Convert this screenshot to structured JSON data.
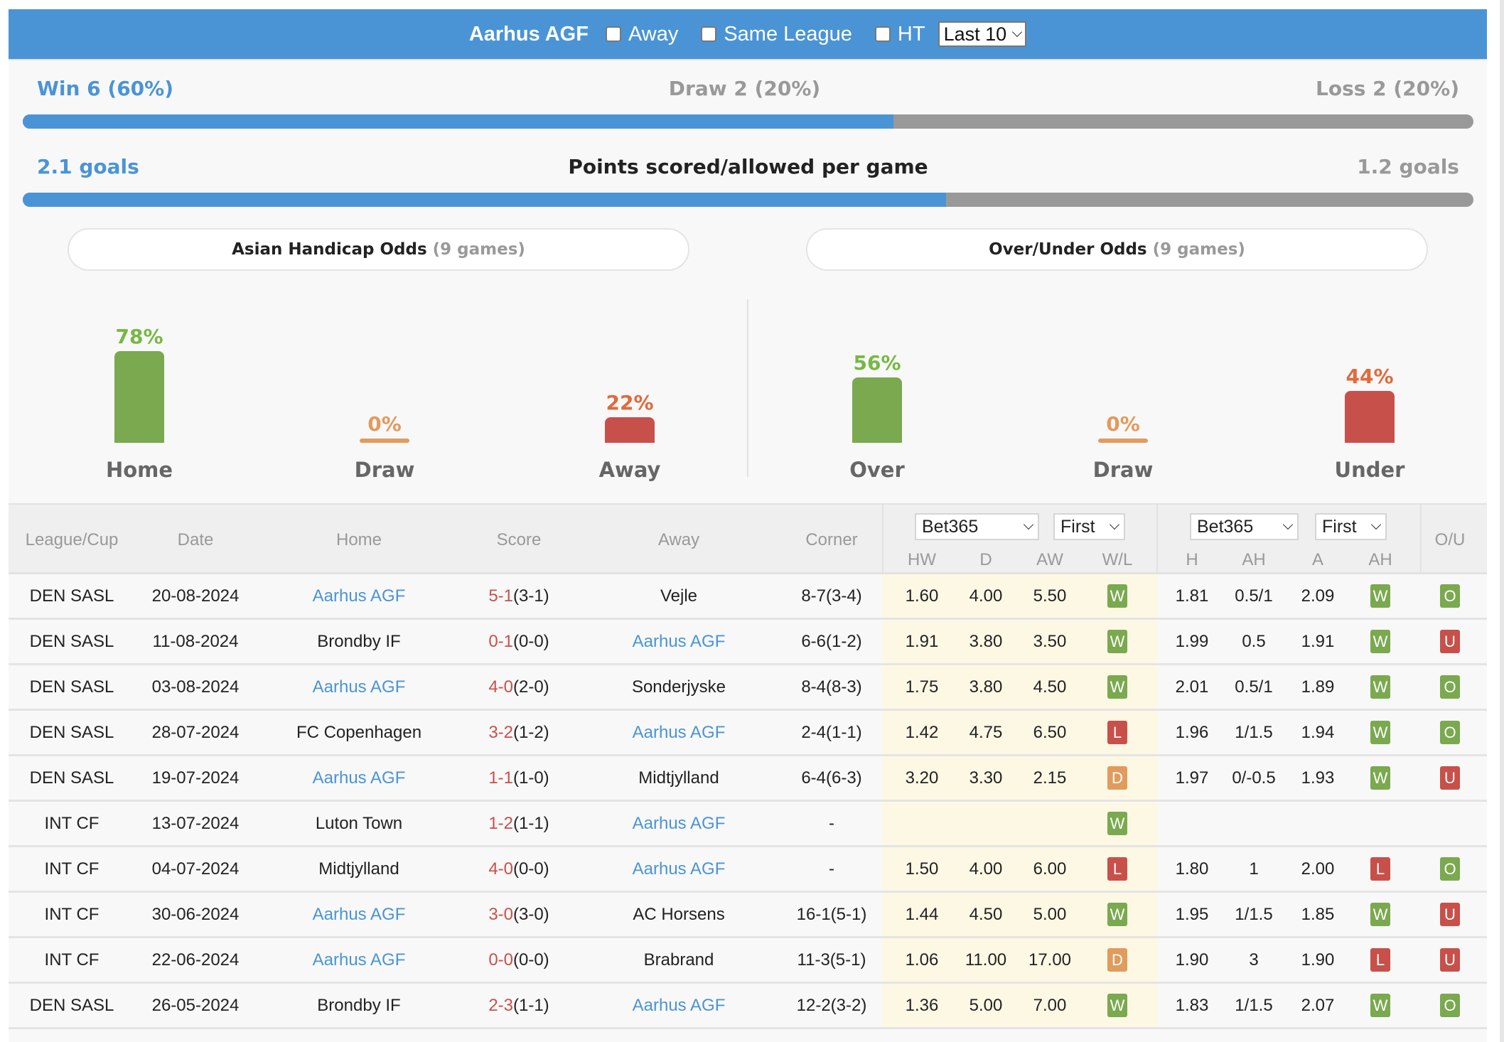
{
  "header": {
    "team": "Aarhus AGF",
    "options": [
      {
        "label": "Away",
        "checked": false
      },
      {
        "label": "Same League",
        "checked": false
      },
      {
        "label": "HT",
        "checked": false
      }
    ],
    "range_select": "Last 10"
  },
  "record": {
    "win_label": "Win 6 (60%)",
    "draw_label": "Draw 2 (20%)",
    "loss_label": "Loss 2 (20%)",
    "win_fraction": 0.6
  },
  "goals": {
    "scored_label": "2.1 goals",
    "title": "Points scored/allowed per game",
    "allowed_label": "1.2 goals",
    "scored": 2.1,
    "allowed": 1.2
  },
  "asian_handicap": {
    "title": "Asian Handicap Odds",
    "games": "(9 games)"
  },
  "over_under": {
    "title": "Over/Under Odds",
    "games": "(9 games)"
  },
  "colors": {
    "accent": "#4a94d6",
    "green": "#7aa94f",
    "green_text": "#76b843",
    "red": "#c8504a",
    "red_text": "#e06a3b",
    "orange": "#e19b5c",
    "grey_bar": "#999999",
    "odds_bg": "#fdf8e4"
  },
  "chart_data": [
    {
      "type": "bar",
      "title": "Asian Handicap Odds (9 games)",
      "categories": [
        "Home",
        "Draw",
        "Away"
      ],
      "values": [
        78,
        0,
        22
      ],
      "value_labels": [
        "78%",
        "0%",
        "22%"
      ],
      "unit": "%",
      "ylim": [
        0,
        100
      ]
    },
    {
      "type": "bar",
      "title": "Over/Under Odds (9 games)",
      "categories": [
        "Over",
        "Draw",
        "Under"
      ],
      "values": [
        56,
        0,
        44
      ],
      "value_labels": [
        "56%",
        "0%",
        "44%"
      ],
      "unit": "%",
      "ylim": [
        0,
        100
      ]
    }
  ],
  "table": {
    "columns": {
      "league": "League/Cup",
      "date": "Date",
      "home": "Home",
      "score": "Score",
      "away": "Away",
      "corner": "Corner",
      "hw": "HW",
      "d": "D",
      "aw": "AW",
      "wl": "W/L",
      "h": "H",
      "ah": "AH",
      "a": "A",
      "ah_result": "AH",
      "ou": "O/U"
    },
    "odds_company_1": "Bet365",
    "odds_type_1": "First",
    "odds_company_2": "Bet365",
    "odds_type_2": "First",
    "rows": [
      {
        "league": "DEN SASL",
        "date": "20-08-2024",
        "home": "Aarhus AGF",
        "home_link": true,
        "score_ft": "5-1",
        "score_ht": "(3-1)",
        "away": "Vejle",
        "away_link": false,
        "corner": "8-7(3-4)",
        "hw": "1.60",
        "d": "4.00",
        "aw": "5.50",
        "wl": "W",
        "h": "1.81",
        "ah": "0.5/1",
        "a": "2.09",
        "ah_result": "W",
        "ou": "O"
      },
      {
        "league": "DEN SASL",
        "date": "11-08-2024",
        "home": "Brondby IF",
        "home_link": false,
        "score_ft": "0-1",
        "score_ht": "(0-0)",
        "away": "Aarhus AGF",
        "away_link": true,
        "corner": "6-6(1-2)",
        "hw": "1.91",
        "d": "3.80",
        "aw": "3.50",
        "wl": "W",
        "h": "1.99",
        "ah": "0.5",
        "a": "1.91",
        "ah_result": "W",
        "ou": "U"
      },
      {
        "league": "DEN SASL",
        "date": "03-08-2024",
        "home": "Aarhus AGF",
        "home_link": true,
        "score_ft": "4-0",
        "score_ht": "(2-0)",
        "away": "Sonderjyske",
        "away_link": false,
        "corner": "8-4(8-3)",
        "hw": "1.75",
        "d": "3.80",
        "aw": "4.50",
        "wl": "W",
        "h": "2.01",
        "ah": "0.5/1",
        "a": "1.89",
        "ah_result": "W",
        "ou": "O"
      },
      {
        "league": "DEN SASL",
        "date": "28-07-2024",
        "home": "FC Copenhagen",
        "home_link": false,
        "score_ft": "3-2",
        "score_ht": "(1-2)",
        "away": "Aarhus AGF",
        "away_link": true,
        "corner": "2-4(1-1)",
        "hw": "1.42",
        "d": "4.75",
        "aw": "6.50",
        "wl": "L",
        "h": "1.96",
        "ah": "1/1.5",
        "a": "1.94",
        "ah_result": "W",
        "ou": "O"
      },
      {
        "league": "DEN SASL",
        "date": "19-07-2024",
        "home": "Aarhus AGF",
        "home_link": true,
        "score_ft": "1-1",
        "score_ht": "(1-0)",
        "away": "Midtjylland",
        "away_link": false,
        "corner": "6-4(6-3)",
        "hw": "3.20",
        "d": "3.30",
        "aw": "2.15",
        "wl": "D",
        "h": "1.97",
        "ah": "0/-0.5",
        "a": "1.93",
        "ah_result": "W",
        "ou": "U"
      },
      {
        "league": "INT CF",
        "date": "13-07-2024",
        "home": "Luton Town",
        "home_link": false,
        "score_ft": "1-2",
        "score_ht": "(1-1)",
        "away": "Aarhus AGF",
        "away_link": true,
        "corner": "-",
        "hw": "",
        "d": "",
        "aw": "",
        "wl": "W",
        "h": "",
        "ah": "",
        "a": "",
        "ah_result": "",
        "ou": ""
      },
      {
        "league": "INT CF",
        "date": "04-07-2024",
        "home": "Midtjylland",
        "home_link": false,
        "score_ft": "4-0",
        "score_ht": "(0-0)",
        "away": "Aarhus AGF",
        "away_link": true,
        "corner": "-",
        "hw": "1.50",
        "d": "4.00",
        "aw": "6.00",
        "wl": "L",
        "h": "1.80",
        "ah": "1",
        "a": "2.00",
        "ah_result": "L",
        "ou": "O"
      },
      {
        "league": "INT CF",
        "date": "30-06-2024",
        "home": "Aarhus AGF",
        "home_link": true,
        "score_ft": "3-0",
        "score_ht": "(3-0)",
        "away": "AC Horsens",
        "away_link": false,
        "corner": "16-1(5-1)",
        "hw": "1.44",
        "d": "4.50",
        "aw": "5.00",
        "wl": "W",
        "h": "1.95",
        "ah": "1/1.5",
        "a": "1.85",
        "ah_result": "W",
        "ou": "U"
      },
      {
        "league": "INT CF",
        "date": "22-06-2024",
        "home": "Aarhus AGF",
        "home_link": true,
        "score_ft": "0-0",
        "score_ht": "(0-0)",
        "away": "Brabrand",
        "away_link": false,
        "corner": "11-3(5-1)",
        "hw": "1.06",
        "d": "11.00",
        "aw": "17.00",
        "wl": "D",
        "h": "1.90",
        "ah": "3",
        "a": "1.90",
        "ah_result": "L",
        "ou": "U"
      },
      {
        "league": "DEN SASL",
        "date": "26-05-2024",
        "home": "Brondby IF",
        "home_link": false,
        "score_ft": "2-3",
        "score_ht": "(1-1)",
        "away": "Aarhus AGF",
        "away_link": true,
        "corner": "12-2(3-2)",
        "hw": "1.36",
        "d": "5.00",
        "aw": "7.00",
        "wl": "W",
        "h": "1.83",
        "ah": "1/1.5",
        "a": "2.07",
        "ah_result": "W",
        "ou": "O"
      }
    ]
  }
}
